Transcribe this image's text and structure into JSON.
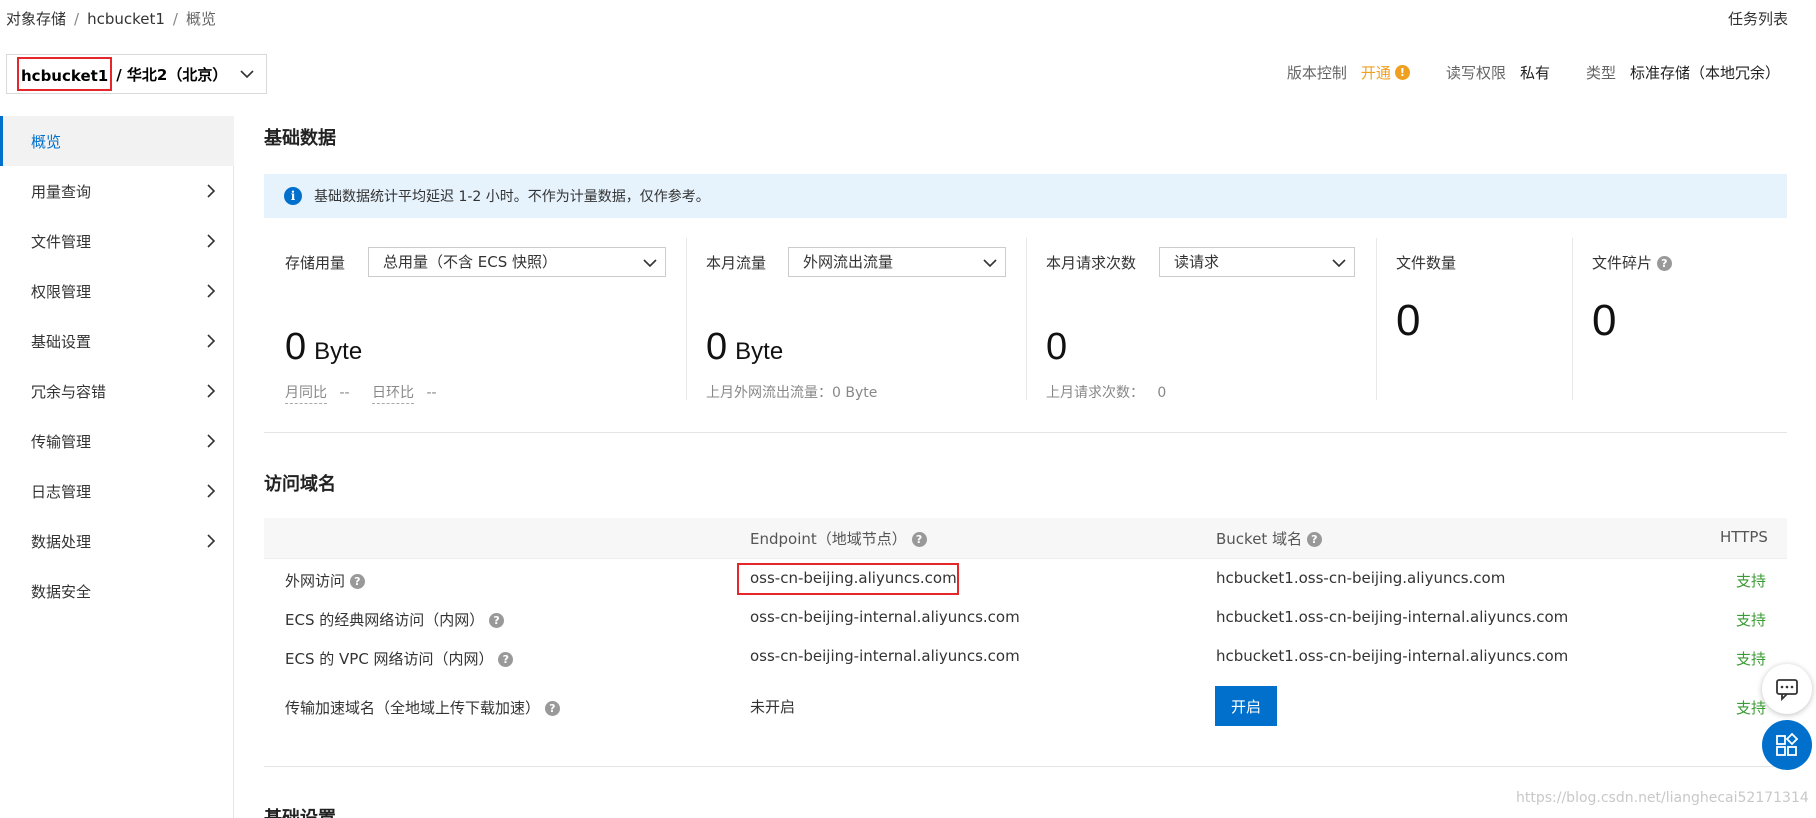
{
  "breadcrumb": [
    "对象存储",
    "hcbucket1",
    "概览"
  ],
  "task_list": "任务列表",
  "bucket": {
    "name": "hcbucket1",
    "region": "/ 华北2（北京）"
  },
  "meta": {
    "version_label": "版本控制",
    "version_value": "开通",
    "rw_label": "读写权限",
    "rw_value": "私有",
    "type_label": "类型",
    "type_value": "标准存储（本地冗余）"
  },
  "sidebar": {
    "items": [
      {
        "label": "概览",
        "active": true
      },
      {
        "label": "用量查询"
      },
      {
        "label": "文件管理"
      },
      {
        "label": "权限管理"
      },
      {
        "label": "基础设置"
      },
      {
        "label": "冗余与容错"
      },
      {
        "label": "传输管理"
      },
      {
        "label": "日志管理"
      },
      {
        "label": "数据处理"
      },
      {
        "label": "数据安全"
      }
    ]
  },
  "basic": {
    "title": "基础数据",
    "notice": "基础数据统计平均延迟 1-2 小时。不作为计量数据，仅作参考。",
    "storage": {
      "label": "存储用量",
      "select": "总用量（不含 ECS 快照）",
      "value": "0",
      "unit": "Byte",
      "mom": "月同比",
      "dod": "日环比",
      "mom_val": "--",
      "dod_val": "--"
    },
    "traffic": {
      "label": "本月流量",
      "select": "外网流出流量",
      "value": "0",
      "unit": "Byte",
      "sub": "上月外网流出流量：0 Byte"
    },
    "requests": {
      "label": "本月请求次数",
      "select": "读请求",
      "value": "0",
      "sub": "上月请求次数：   0"
    },
    "files": {
      "label": "文件数量",
      "value": "0"
    },
    "fragments": {
      "label": "文件碎片",
      "value": "0"
    }
  },
  "domains": {
    "title": "访问域名",
    "headers": {
      "endpoint": "Endpoint（地域节点）",
      "bucket": "Bucket 域名",
      "https": "HTTPS"
    },
    "rows": [
      {
        "name": "外网访问",
        "endpoint": "oss-cn-beijing.aliyuncs.com",
        "bucket": "hcbucket1.oss-cn-beijing.aliyuncs.com",
        "https": "支持"
      },
      {
        "name": "ECS 的经典网络访问（内网）",
        "endpoint": "oss-cn-beijing-internal.aliyuncs.com",
        "bucket": "hcbucket1.oss-cn-beijing-internal.aliyuncs.com",
        "https": "支持"
      },
      {
        "name": "ECS 的 VPC 网络访问（内网）",
        "endpoint": "oss-cn-beijing-internal.aliyuncs.com",
        "bucket": "hcbucket1.oss-cn-beijing-internal.aliyuncs.com",
        "https": "支持"
      },
      {
        "name": "传输加速域名（全地域上传下载加速）",
        "endpoint": "未开启",
        "button": "开启",
        "https": "支持"
      }
    ]
  },
  "next_section": "基础设置",
  "watermark": "https://blog.csdn.net/lianghecai52171314",
  "colors": {
    "accent": "#0070cc",
    "support": "#3a9a33",
    "warning": "#f0a020",
    "highlight": "#e5262b"
  }
}
